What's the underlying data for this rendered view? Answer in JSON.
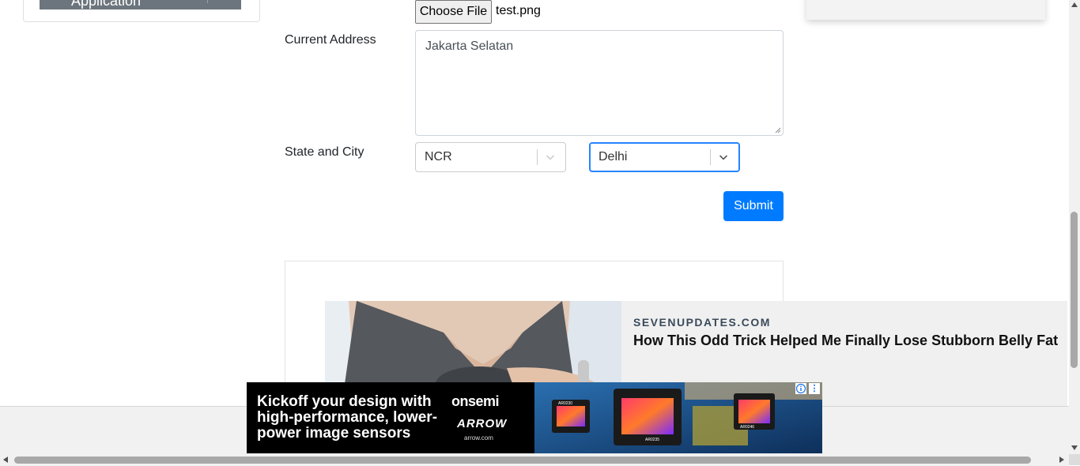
{
  "sidebar": {
    "active_item_label": "Application"
  },
  "form": {
    "file_button_label": "Choose File",
    "file_name": "test.png",
    "address_label": "Current Address",
    "address_value": "Jakarta Selatan",
    "state_city_label": "State and City",
    "state_value": "NCR",
    "city_value": "Delhi",
    "submit_label": "Submit"
  },
  "native_ad": {
    "domain": "SEVENUPDATES.COM",
    "headline": "How This Odd Trick Helped Me Finally Lose Stubborn Belly Fat"
  },
  "banner_ad": {
    "text": "Kickoff your design with high-performance, lower-power image sensors",
    "brand": "onsemi",
    "partner": "ARROW",
    "url": "arrow.com",
    "chip_labels": [
      "AR0230",
      "AR0235",
      "AR0246"
    ]
  },
  "colors": {
    "primary_button": "#007bff",
    "focus_border": "#2684ff",
    "sidebar_active": "#6c757d"
  }
}
